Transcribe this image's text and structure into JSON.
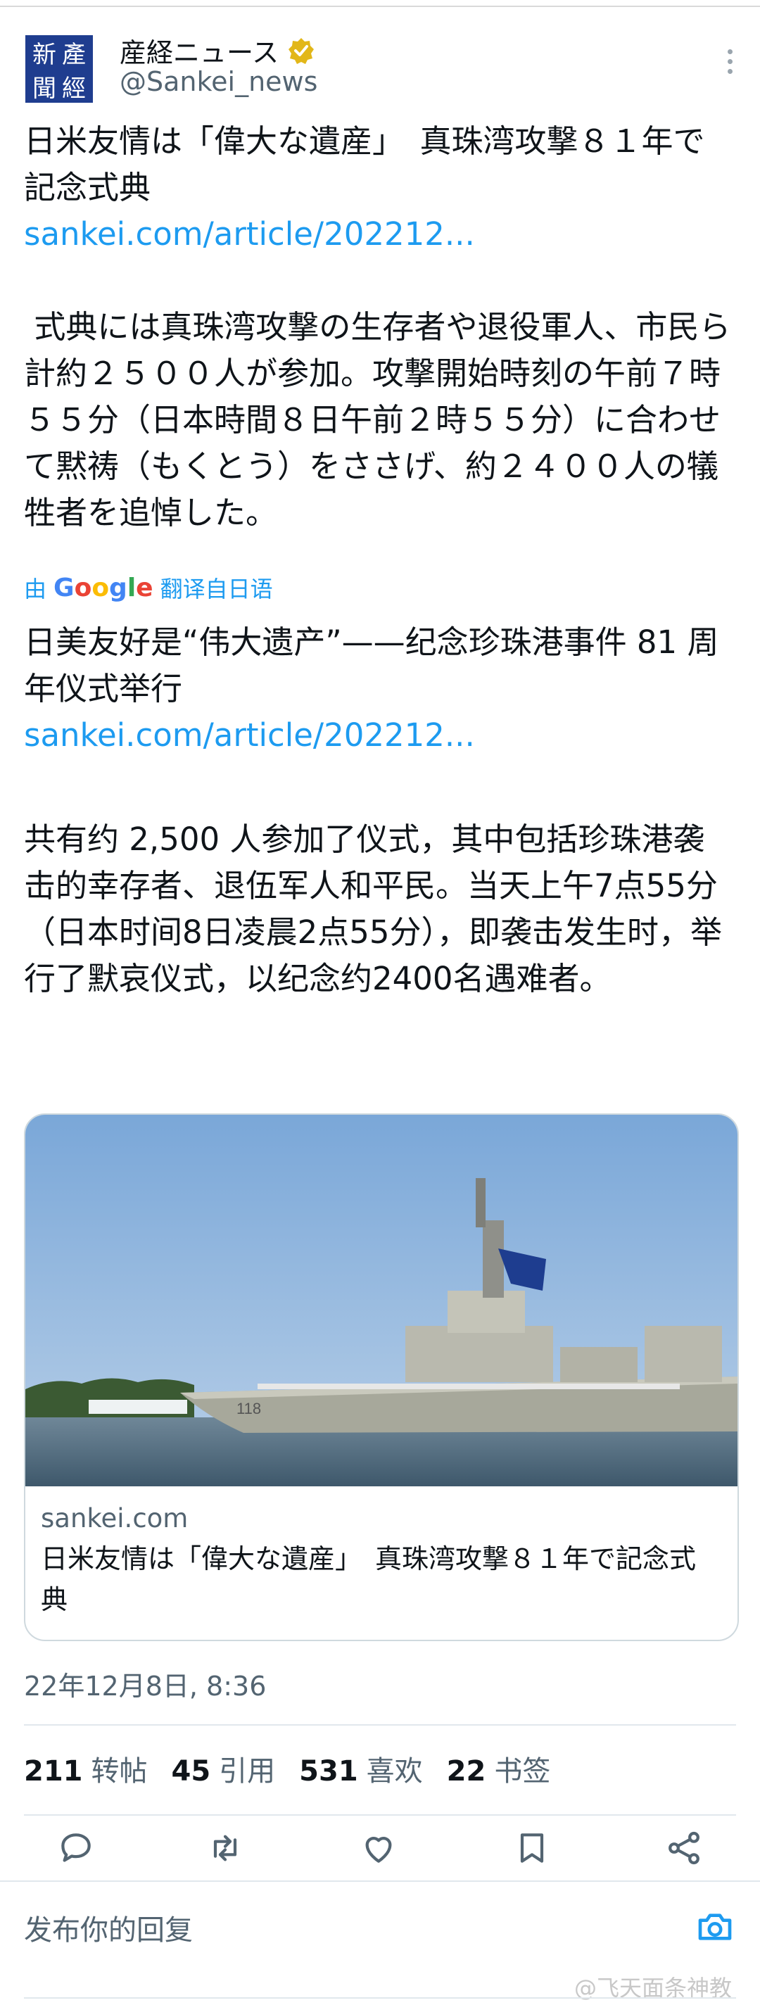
{
  "account": {
    "name": "産経ニュース",
    "handle": "@Sankei_news",
    "avatar_chars": [
      "新",
      "產",
      "聞",
      "經"
    ]
  },
  "tweet": {
    "original_title": "日米友情は「偉大な遺産」　真珠湾攻撃８１年で記念式典",
    "original_link": "sankei.com/article/202212...",
    "original_body": " 式典には真珠湾攻撃の生存者や退役軍人、市民ら計約２５００人が参加。攻撃開始時刻の午前７時５５分（日本時間８日午前２時５５分）に合わせて黙祷（もくとう）をささげ、約２４００人の犠牲者を追悼した。",
    "translate_prefix": "由",
    "translate_brand": "Google",
    "translate_suffix": "翻译自日语",
    "translated_title": "日美友好是“伟大遗产”——纪念珍珠港事件 81 周年仪式举行",
    "translated_link": "sankei.com/article/202212...",
    "translated_body": "共有约 2,500 人参加了仪式，其中包括珍珠港袭击的幸存者、退伍军人和平民。当天上午7点55分（日本时间8日凌晨2点55分），即袭击发生时，举行了默哀仪式，以纪念约2400名遇难者。"
  },
  "card": {
    "domain": "sankei.com",
    "title": "日米友情は「偉大な遺産」　真珠湾攻撃８１年で記念式典",
    "hull_number": "118"
  },
  "meta": {
    "timestamp": "22年12月8日, 8:36"
  },
  "stats": {
    "retweets_count": "211",
    "retweets_label": "转帖",
    "quotes_count": "45",
    "quotes_label": "引用",
    "likes_count": "531",
    "likes_label": "喜欢",
    "bookmarks_count": "22",
    "bookmarks_label": "书签"
  },
  "reply": {
    "placeholder": "发布你的回复"
  },
  "watermark": "@飞天面条神教",
  "colors": {
    "link": "#1d9bf0",
    "secondary_text": "#536471",
    "verified_gold": "#e2b719"
  },
  "icons": [
    "more-icon",
    "verified-icon",
    "reply-icon",
    "retweet-icon",
    "like-icon",
    "bookmark-icon",
    "share-icon",
    "camera-icon"
  ]
}
